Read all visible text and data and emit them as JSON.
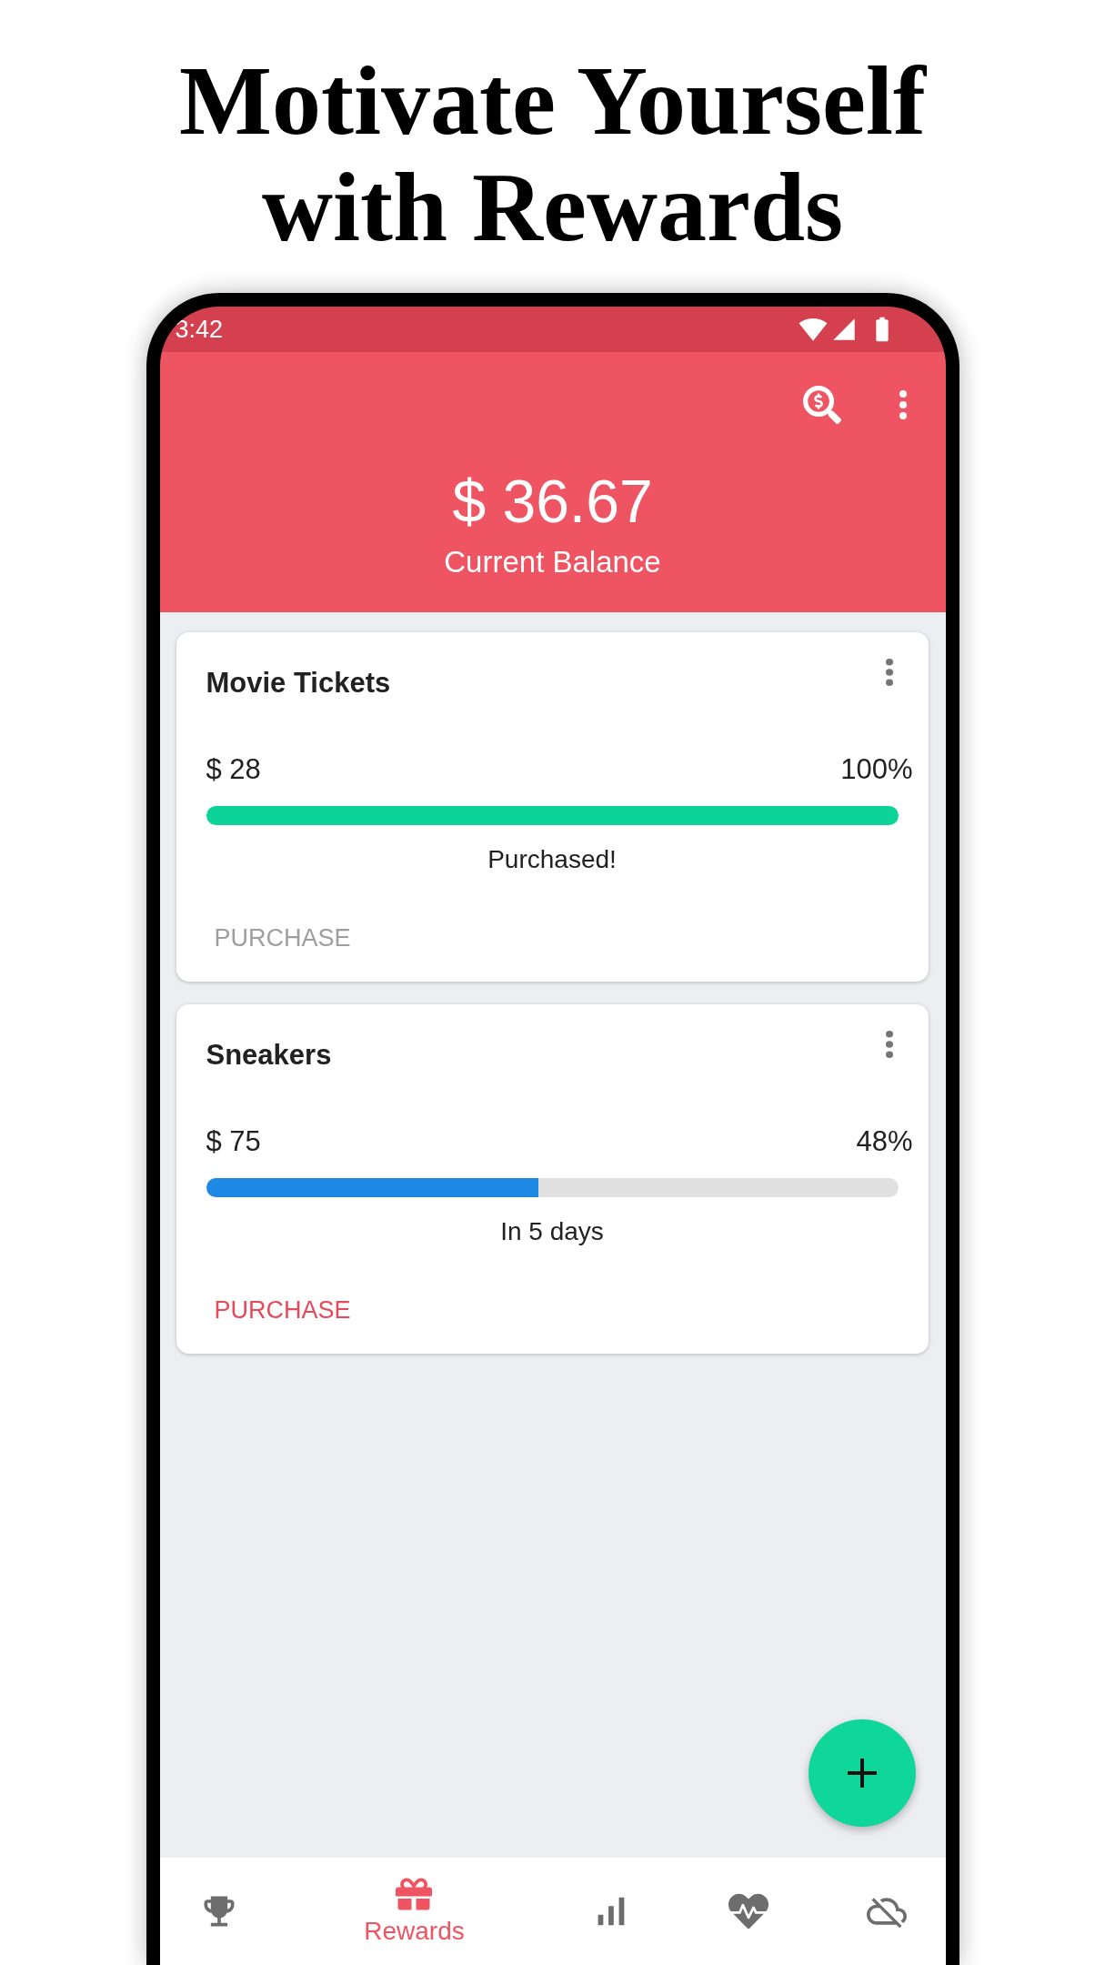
{
  "headline": "Motivate Yourself with Rewards",
  "status_bar": {
    "time": "3:42"
  },
  "header": {
    "balance": "$ 36.67",
    "balance_label": "Current Balance"
  },
  "rewards": [
    {
      "title": "Movie Tickets",
      "price": "$ 28",
      "percent": "100%",
      "level": 1,
      "status": "Purchased!",
      "action": "PURCHASE",
      "purchased": true
    },
    {
      "title": "Sneakers",
      "price": "$ 75",
      "percent": "48%",
      "level": 0.48,
      "status": "In 5 days",
      "action": "PURCHASE",
      "purchased": false
    }
  ],
  "bottom_nav": [
    {
      "selected": false
    },
    {
      "label": "Rewards",
      "selected": true
    },
    {
      "selected": false
    },
    {
      "selected": false
    },
    {
      "selected": false
    }
  ]
}
